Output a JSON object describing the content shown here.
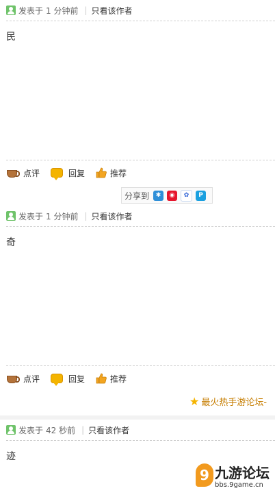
{
  "posts": [
    {
      "posted_prefix": "发表于",
      "time": "1 分钟前",
      "author_only": "只看该作者",
      "content": "民",
      "actions": {
        "comment": "点评",
        "reply": "回复",
        "recommend": "推荐"
      },
      "share_label": "分享到"
    },
    {
      "posted_prefix": "发表于",
      "time": "1 分钟前",
      "author_only": "只看该作者",
      "content": "奇",
      "actions": {
        "comment": "点评",
        "reply": "回复",
        "recommend": "推荐"
      },
      "promo": "最火热手游论坛-"
    },
    {
      "posted_prefix": "发表于",
      "time": "42 秒前",
      "author_only": "只看该作者",
      "content": "迹"
    }
  ],
  "watermark": {
    "glyph": "9",
    "title": "九游论坛",
    "subtitle": "bbs.9game.cn"
  },
  "icons": [
    "avatar-icon",
    "cup-icon",
    "bubble-icon",
    "thumb-icon",
    "qzone-icon",
    "weibo-icon",
    "baidu-icon",
    "pengyou-icon",
    "star-icon"
  ]
}
